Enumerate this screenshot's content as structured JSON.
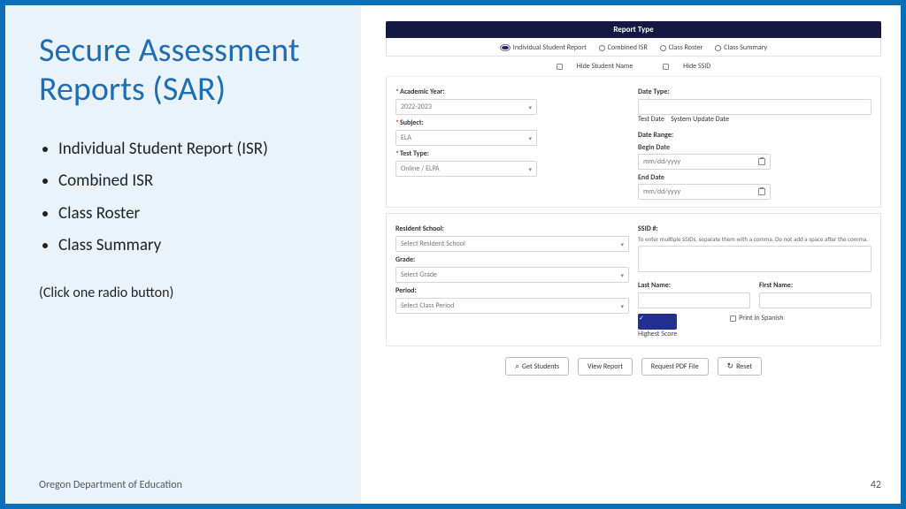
{
  "title": "Secure Assessment Reports (SAR)",
  "bullets": [
    "Individual Student Report (ISR)",
    "Combined ISR",
    "Class Roster",
    "Class Summary"
  ],
  "note": "(Click one radio button)",
  "footer": {
    "org": "Oregon Department of Education",
    "page": "42"
  },
  "form": {
    "header": "Report Type",
    "reportTypes": {
      "isr": "Individual Student Report",
      "combined": "Combined ISR",
      "roster": "Class Roster",
      "summary": "Class Summary"
    },
    "hide": {
      "name": "Hide Student Name",
      "ssid": "Hide SSID"
    },
    "left1": {
      "year_lbl": "Academic Year:",
      "year_val": "2022-2023",
      "subj_lbl": "Subject:",
      "subj_val": "ELA",
      "tt_lbl": "Test Type:",
      "tt_val": "Online / ELPA"
    },
    "right1": {
      "dt_lbl": "Date Type:",
      "dt_test": "Test Date",
      "dt_sys": "System Update Date",
      "dr_lbl": "Date Range:",
      "begin_lbl": "Begin Date",
      "end_lbl": "End Date",
      "ph": "mm/dd/yyyy"
    },
    "left2": {
      "school_lbl": "Resident School:",
      "school_val": "Select Resident School",
      "grade_lbl": "Grade:",
      "grade_val": "Select Grade",
      "period_lbl": "Period:",
      "period_val": "Select Class Period"
    },
    "right2": {
      "ssid_lbl": "SSID #:",
      "ssid_help": "To enter multiple SSIDs, separate them with a comma. Do not add a space after the comma.",
      "last_lbl": "Last Name:",
      "first_lbl": "First Name:",
      "highest": "Highest Score",
      "spanish": "Print in Spanish"
    },
    "buttons": {
      "get": "Get Students",
      "view": "View Report",
      "pdf": "Request PDF File",
      "reset": "Reset"
    }
  }
}
